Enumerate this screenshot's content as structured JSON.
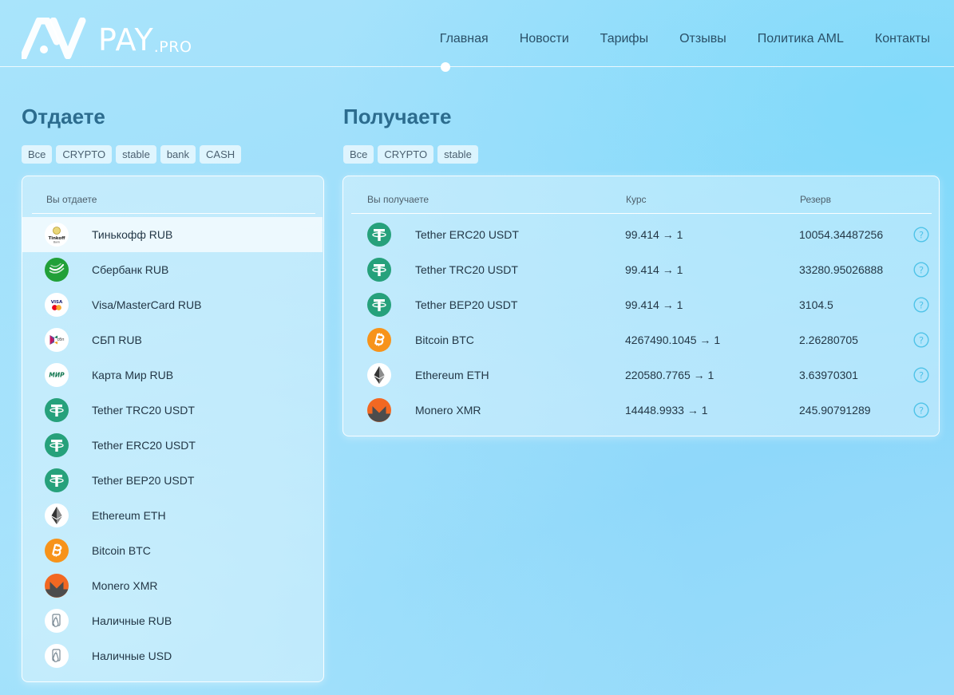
{
  "brand": {
    "pay": "PAY",
    "pro": ".PRO"
  },
  "nav": [
    {
      "label": "Главная"
    },
    {
      "label": "Новости"
    },
    {
      "label": "Тарифы"
    },
    {
      "label": "Отзывы"
    },
    {
      "label": "Политика AML"
    },
    {
      "label": "Контакты"
    }
  ],
  "give": {
    "title": "Отдаете",
    "filters": [
      "Все",
      "CRYPTO",
      "stable",
      "bank",
      "CASH"
    ],
    "column_header": "Вы отдаете",
    "selected_index": 0,
    "items": [
      {
        "label": "Тинькофф RUB",
        "icon": "tinkoff-icon"
      },
      {
        "label": "Сбербанк RUB",
        "icon": "sberbank-icon"
      },
      {
        "label": "Visa/MasterCard RUB",
        "icon": "visa-mastercard-icon"
      },
      {
        "label": "СБП RUB",
        "icon": "sbp-icon"
      },
      {
        "label": "Карта Мир RUB",
        "icon": "mir-icon"
      },
      {
        "label": "Tether TRC20 USDT",
        "icon": "tether-icon"
      },
      {
        "label": "Tether ERC20 USDT",
        "icon": "tether-icon"
      },
      {
        "label": "Tether BEP20 USDT",
        "icon": "tether-icon"
      },
      {
        "label": "Ethereum ETH",
        "icon": "ethereum-icon"
      },
      {
        "label": "Bitcoin BTC",
        "icon": "bitcoin-icon"
      },
      {
        "label": "Monero XMR",
        "icon": "monero-icon"
      },
      {
        "label": "Наличные RUB",
        "icon": "cash-icon"
      },
      {
        "label": "Наличные USD",
        "icon": "cash-icon"
      }
    ],
    "icon_text": {
      "tinkoff": "Tinkoff",
      "tinkoff_sub": "Bank",
      "visa": "VISA",
      "sbp": "сбп",
      "mir": "МИР"
    }
  },
  "get": {
    "title": "Получаете",
    "filters": [
      "Все",
      "CRYPTO",
      "stable"
    ],
    "column_headers": {
      "name": "Вы получаете",
      "rate": "Курс",
      "reserve": "Резерв"
    },
    "items": [
      {
        "label": "Tether ERC20 USDT",
        "rate": "99.414 → 1",
        "reserve": "10054.34487256",
        "icon": "tether-icon"
      },
      {
        "label": "Tether TRC20 USDT",
        "rate": "99.414 → 1",
        "reserve": "33280.95026888",
        "icon": "tether-icon"
      },
      {
        "label": "Tether BEP20 USDT",
        "rate": "99.414 → 1",
        "reserve": "3104.5",
        "icon": "tether-icon"
      },
      {
        "label": "Bitcoin BTC",
        "rate": "4267490.1045 → 1",
        "reserve": "2.26280705",
        "icon": "bitcoin-icon"
      },
      {
        "label": "Ethereum ETH",
        "rate": "220580.7765 → 1",
        "reserve": "3.63970301",
        "icon": "ethereum-icon"
      },
      {
        "label": "Monero XMR",
        "rate": "14448.9933 → 1",
        "reserve": "245.90791289",
        "icon": "monero-icon"
      }
    ],
    "help_glyph": "?"
  },
  "colors": {
    "tether": "#26a17b",
    "bitcoin": "#f7931a",
    "monero": "#f26822",
    "title": "#2c6c8e",
    "help": "#4fc3e8"
  }
}
